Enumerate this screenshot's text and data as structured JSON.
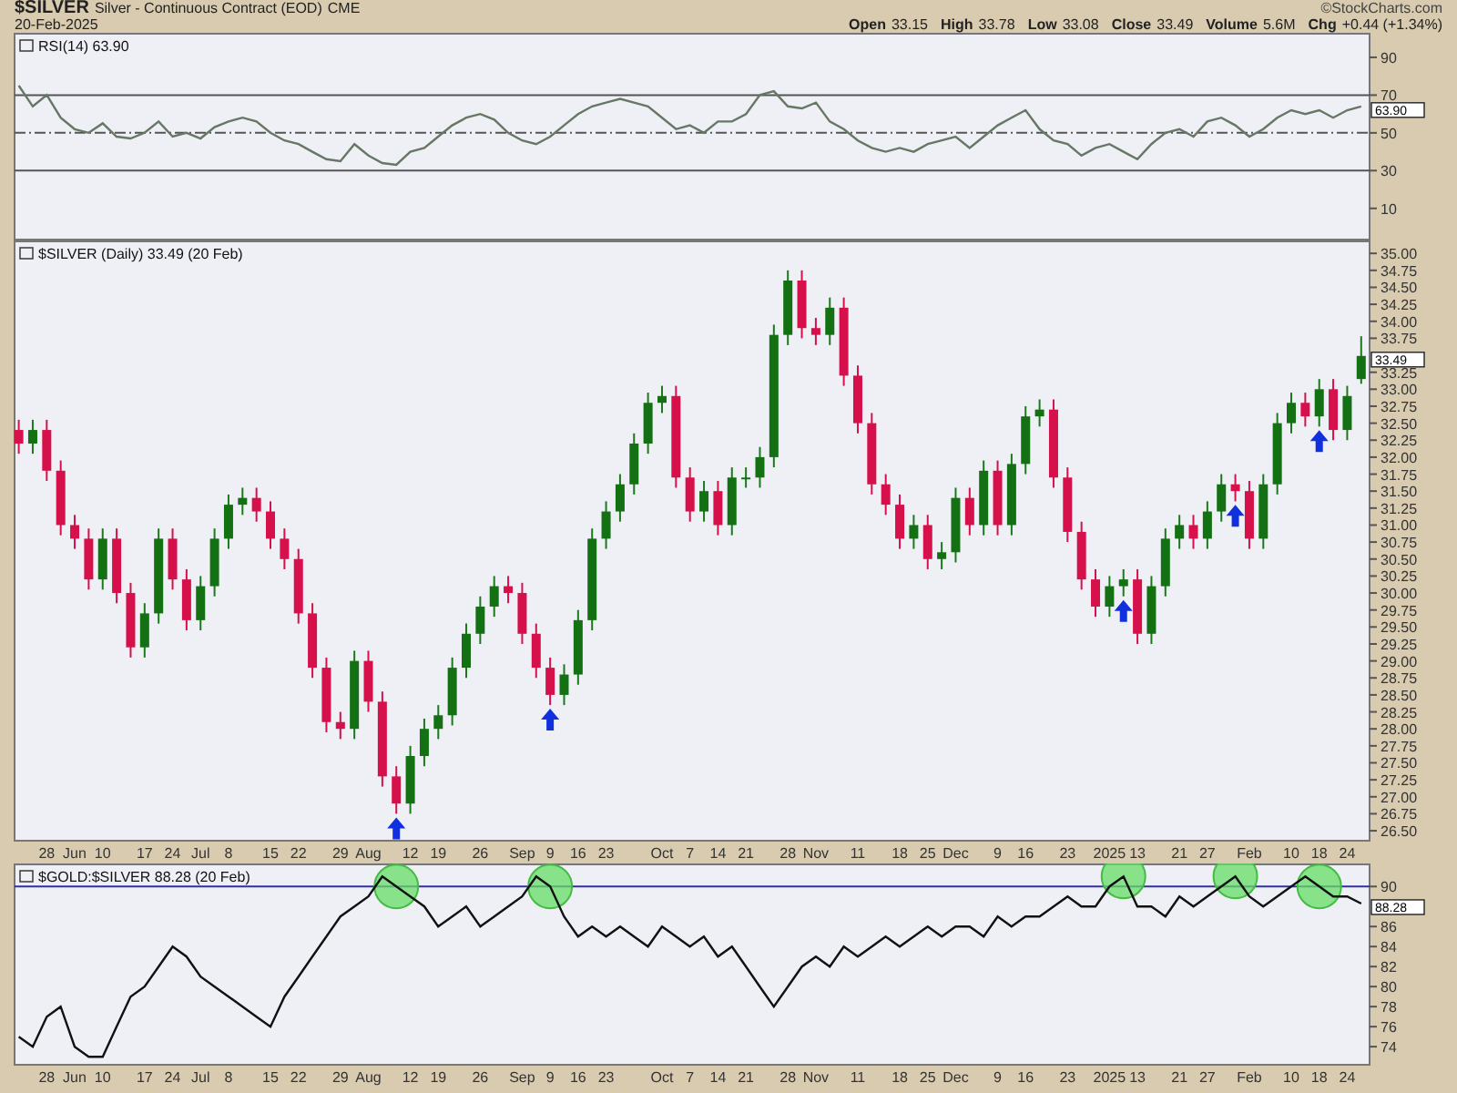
{
  "header": {
    "symbol": "$SILVER",
    "name": "Silver - Continuous Contract (EOD)",
    "exchange": "CME",
    "date": "20-Feb-2025",
    "credit": "©StockCharts.com",
    "quote": [
      {
        "label": "Open",
        "value": "33.15"
      },
      {
        "label": "High",
        "value": "33.78"
      },
      {
        "label": "Low",
        "value": "33.08"
      },
      {
        "label": "Close",
        "value": "33.49"
      },
      {
        "label": "Volume",
        "value": "5.6M"
      },
      {
        "label": "Chg",
        "value": "+0.44 (+1.34%)"
      }
    ]
  },
  "rsi_panel": {
    "legend_value": "63.90",
    "last_value": "63.90",
    "chart_data": {
      "type": "line",
      "ylim": [
        -7,
        103
      ],
      "yticks": [
        10,
        30,
        50,
        70,
        90
      ],
      "series": [
        {
          "name": "RSI(14)",
          "color": "#667766",
          "values": [
            75,
            64,
            70,
            58,
            52,
            50,
            55,
            48,
            47,
            50,
            56,
            48,
            50,
            47,
            53,
            56,
            58,
            56,
            50,
            46,
            44,
            40,
            36,
            35,
            44,
            38,
            34,
            33,
            40,
            42,
            48,
            54,
            58,
            60,
            57,
            50,
            46,
            44,
            48,
            54,
            60,
            64,
            66,
            68,
            66,
            64,
            58,
            52,
            54,
            50,
            56,
            56,
            60,
            70,
            72,
            64,
            63,
            66,
            56,
            52,
            46,
            42,
            40,
            42,
            40,
            44,
            46,
            48,
            42,
            48,
            54,
            58,
            62,
            52,
            46,
            44,
            38,
            42,
            44,
            40,
            36,
            44,
            50,
            52,
            48,
            56,
            58,
            54,
            48,
            52,
            58,
            62,
            60,
            62,
            58,
            62,
            64
          ]
        }
      ],
      "ref_lines": [
        {
          "axis": "y",
          "value": 70
        },
        {
          "axis": "y",
          "value": 50
        },
        {
          "axis": "y",
          "value": 30
        }
      ]
    }
  },
  "price_panel": {
    "legend_detail": "(Daily) 33.49 (20 Feb)",
    "last_value": "33.49",
    "chart_data": {
      "type": "candlestick",
      "title": "$SILVER",
      "ylim": [
        26.34,
        35.19
      ],
      "yticks": [
        {
          "value": 35,
          "label": "35.00"
        },
        {
          "value": 34.75,
          "label": "34.75"
        },
        {
          "value": 34.5,
          "label": "34.50"
        },
        {
          "value": 34.25,
          "label": "34.25"
        },
        {
          "value": 34,
          "label": "34.00"
        },
        {
          "value": 33.75,
          "label": "33.75"
        },
        {
          "value": 33.25,
          "label": "33.25"
        },
        {
          "value": 33,
          "label": "33.00"
        },
        {
          "value": 32.75,
          "label": "32.75"
        },
        {
          "value": 32.5,
          "label": "32.50"
        },
        {
          "value": 32.25,
          "label": "32.25"
        },
        {
          "value": 32,
          "label": "32.00"
        },
        {
          "value": 31.75,
          "label": "31.75"
        },
        {
          "value": 31.5,
          "label": "31.50"
        },
        {
          "value": 31.25,
          "label": "31.25"
        },
        {
          "value": 31,
          "label": "31.00"
        },
        {
          "value": 30.75,
          "label": "30.75"
        },
        {
          "value": 30.5,
          "label": "30.50"
        },
        {
          "value": 30.25,
          "label": "30.25"
        },
        {
          "value": 30,
          "label": "30.00"
        },
        {
          "value": 29.75,
          "label": "29.75"
        },
        {
          "value": 29.5,
          "label": "29.50"
        },
        {
          "value": 29.25,
          "label": "29.25"
        },
        {
          "value": 29,
          "label": "29.00"
        },
        {
          "value": 28.75,
          "label": "28.75"
        },
        {
          "value": 28.5,
          "label": "28.50"
        },
        {
          "value": 28.25,
          "label": "28.25"
        },
        {
          "value": 28,
          "label": "28.00"
        },
        {
          "value": 27.75,
          "label": "27.75"
        },
        {
          "value": 27.5,
          "label": "27.50"
        },
        {
          "value": 27.25,
          "label": "27.25"
        },
        {
          "value": 27,
          "label": "27.00"
        },
        {
          "value": 26.75,
          "label": "26.75"
        },
        {
          "value": 26.5,
          "label": "26.50"
        }
      ],
      "categories": [
        null,
        null,
        "28",
        null,
        "Jun",
        null,
        "10",
        null,
        null,
        "17",
        null,
        "24",
        null,
        "Jul",
        null,
        "8",
        null,
        null,
        "15",
        null,
        "22",
        null,
        null,
        "29",
        null,
        "Aug",
        null,
        null,
        "12",
        null,
        "19",
        null,
        null,
        "26",
        null,
        null,
        "Sep",
        null,
        "9",
        null,
        "16",
        null,
        "23",
        null,
        null,
        null,
        "Oct",
        null,
        "7",
        null,
        "14",
        null,
        "21",
        null,
        null,
        "28",
        null,
        "Nov",
        null,
        null,
        "11",
        null,
        null,
        "18",
        null,
        "25",
        null,
        "Dec",
        null,
        null,
        "9",
        null,
        "16",
        null,
        null,
        "23",
        null,
        null,
        "2025",
        null,
        "13",
        null,
        null,
        "21",
        null,
        "27",
        null,
        null,
        "Feb",
        null,
        null,
        "10",
        null,
        "18",
        null,
        "24",
        null
      ],
      "ohlc": [
        [
          32.4,
          32.55,
          32.05,
          32.2
        ],
        [
          32.2,
          32.55,
          32.05,
          32.4
        ],
        [
          32.4,
          32.55,
          31.65,
          31.8
        ],
        [
          31.8,
          31.95,
          30.85,
          31.0
        ],
        [
          31.0,
          31.15,
          30.65,
          30.8
        ],
        [
          30.8,
          30.95,
          30.05,
          30.2
        ],
        [
          30.2,
          30.95,
          30.05,
          30.8
        ],
        [
          30.8,
          30.95,
          29.85,
          30.0
        ],
        [
          30.0,
          30.15,
          29.05,
          29.2
        ],
        [
          29.2,
          29.85,
          29.05,
          29.7
        ],
        [
          29.7,
          30.95,
          29.55,
          30.8
        ],
        [
          30.8,
          30.95,
          30.05,
          30.2
        ],
        [
          30.2,
          30.35,
          29.45,
          29.6
        ],
        [
          29.6,
          30.25,
          29.45,
          30.1
        ],
        [
          30.1,
          30.95,
          29.95,
          30.8
        ],
        [
          30.8,
          31.45,
          30.65,
          31.3
        ],
        [
          31.3,
          31.55,
          31.15,
          31.4
        ],
        [
          31.4,
          31.55,
          31.05,
          31.2
        ],
        [
          31.2,
          31.35,
          30.65,
          30.8
        ],
        [
          30.8,
          30.95,
          30.35,
          30.5
        ],
        [
          30.5,
          30.65,
          29.55,
          29.7
        ],
        [
          29.7,
          29.85,
          28.75,
          28.9
        ],
        [
          28.9,
          29.05,
          27.95,
          28.1
        ],
        [
          28.1,
          28.25,
          27.85,
          28.0
        ],
        [
          28.0,
          29.15,
          27.85,
          29.0
        ],
        [
          29.0,
          29.15,
          28.25,
          28.4
        ],
        [
          28.4,
          28.55,
          27.15,
          27.3
        ],
        [
          27.3,
          27.45,
          26.75,
          26.9
        ],
        [
          26.9,
          27.75,
          26.75,
          27.6
        ],
        [
          27.6,
          28.15,
          27.45,
          28.0
        ],
        [
          28.0,
          28.35,
          27.85,
          28.2
        ],
        [
          28.2,
          29.05,
          28.05,
          28.9
        ],
        [
          28.9,
          29.55,
          28.75,
          29.4
        ],
        [
          29.4,
          29.95,
          29.25,
          29.8
        ],
        [
          29.8,
          30.25,
          29.65,
          30.1
        ],
        [
          30.1,
          30.25,
          29.85,
          30.0
        ],
        [
          30.0,
          30.15,
          29.25,
          29.4
        ],
        [
          29.4,
          29.55,
          28.75,
          28.9
        ],
        [
          28.9,
          29.05,
          28.35,
          28.5
        ],
        [
          28.5,
          28.95,
          28.35,
          28.8
        ],
        [
          28.8,
          29.75,
          28.65,
          29.6
        ],
        [
          29.6,
          30.95,
          29.45,
          30.8
        ],
        [
          30.8,
          31.35,
          30.65,
          31.2
        ],
        [
          31.2,
          31.75,
          31.05,
          31.6
        ],
        [
          31.6,
          32.35,
          31.45,
          32.2
        ],
        [
          32.2,
          32.95,
          32.05,
          32.8
        ],
        [
          32.8,
          33.05,
          32.65,
          32.9
        ],
        [
          32.9,
          33.05,
          31.55,
          31.7
        ],
        [
          31.7,
          31.85,
          31.05,
          31.2
        ],
        [
          31.2,
          31.65,
          31.05,
          31.5
        ],
        [
          31.5,
          31.65,
          30.85,
          31.0
        ],
        [
          31.0,
          31.85,
          30.85,
          31.7
        ],
        [
          31.7,
          31.85,
          31.55,
          31.7
        ],
        [
          31.7,
          32.15,
          31.55,
          32.0
        ],
        [
          32.0,
          33.95,
          31.85,
          33.8
        ],
        [
          33.8,
          34.75,
          33.65,
          34.6
        ],
        [
          34.6,
          34.75,
          33.75,
          33.9
        ],
        [
          33.9,
          34.05,
          33.65,
          33.8
        ],
        [
          33.8,
          34.35,
          33.65,
          34.2
        ],
        [
          34.2,
          34.35,
          33.05,
          33.2
        ],
        [
          33.2,
          33.35,
          32.35,
          32.5
        ],
        [
          32.5,
          32.65,
          31.45,
          31.6
        ],
        [
          31.6,
          31.75,
          31.15,
          31.3
        ],
        [
          31.3,
          31.45,
          30.65,
          30.8
        ],
        [
          30.8,
          31.15,
          30.65,
          31.0
        ],
        [
          31.0,
          31.15,
          30.35,
          30.5
        ],
        [
          30.5,
          30.75,
          30.35,
          30.6
        ],
        [
          30.6,
          31.55,
          30.45,
          31.4
        ],
        [
          31.4,
          31.55,
          30.85,
          31.0
        ],
        [
          31.0,
          31.95,
          30.85,
          31.8
        ],
        [
          31.8,
          31.95,
          30.85,
          31.0
        ],
        [
          31.0,
          32.05,
          30.85,
          31.9
        ],
        [
          31.9,
          32.75,
          31.75,
          32.6
        ],
        [
          32.6,
          32.85,
          32.45,
          32.7
        ],
        [
          32.7,
          32.85,
          31.55,
          31.7
        ],
        [
          31.7,
          31.85,
          30.75,
          30.9
        ],
        [
          30.9,
          31.05,
          30.05,
          30.2
        ],
        [
          30.2,
          30.35,
          29.65,
          29.8
        ],
        [
          29.8,
          30.25,
          29.65,
          30.1
        ],
        [
          30.1,
          30.35,
          29.95,
          30.2
        ],
        [
          30.2,
          30.35,
          29.25,
          29.4
        ],
        [
          29.4,
          30.25,
          29.25,
          30.1
        ],
        [
          30.1,
          30.95,
          29.95,
          30.8
        ],
        [
          30.8,
          31.15,
          30.65,
          31.0
        ],
        [
          31.0,
          31.15,
          30.65,
          30.8
        ],
        [
          30.8,
          31.35,
          30.65,
          31.2
        ],
        [
          31.2,
          31.75,
          31.05,
          31.6
        ],
        [
          31.6,
          31.75,
          31.35,
          31.5
        ],
        [
          31.5,
          31.65,
          30.65,
          30.8
        ],
        [
          30.8,
          31.75,
          30.65,
          31.6
        ],
        [
          31.6,
          32.65,
          31.45,
          32.5
        ],
        [
          32.5,
          32.95,
          32.35,
          32.8
        ],
        [
          32.8,
          32.95,
          32.45,
          32.6
        ],
        [
          32.6,
          33.15,
          32.45,
          33.0
        ],
        [
          33.0,
          33.15,
          32.25,
          32.4
        ],
        [
          32.4,
          33.05,
          32.25,
          32.9
        ],
        [
          33.15,
          33.78,
          33.08,
          33.49
        ]
      ]
    }
  },
  "ratio_panel": {
    "legend_value": "88.28 (20 Feb)",
    "last_value": "88.28",
    "chart_data": {
      "type": "line",
      "ylim": [
        72.1,
        92.3
      ],
      "yticks": [
        74,
        76,
        78,
        80,
        82,
        84,
        86,
        90
      ],
      "categories": [
        null,
        null,
        "28",
        null,
        "Jun",
        null,
        "10",
        null,
        null,
        "17",
        null,
        "24",
        null,
        "Jul",
        null,
        "8",
        null,
        null,
        "15",
        null,
        "22",
        null,
        null,
        "29",
        null,
        "Aug",
        null,
        null,
        "12",
        null,
        "19",
        null,
        null,
        "26",
        null,
        null,
        "Sep",
        null,
        "9",
        null,
        "16",
        null,
        "23",
        null,
        null,
        null,
        "Oct",
        null,
        "7",
        null,
        "14",
        null,
        "21",
        null,
        null,
        "28",
        null,
        "Nov",
        null,
        null,
        "11",
        null,
        null,
        "18",
        null,
        "25",
        null,
        "Dec",
        null,
        null,
        "9",
        null,
        "16",
        null,
        null,
        "23",
        null,
        null,
        "2025",
        null,
        "13",
        null,
        null,
        "21",
        null,
        "27",
        null,
        null,
        "Feb",
        null,
        null,
        "10",
        null,
        "18",
        null,
        "24",
        null
      ],
      "series": [
        {
          "name": "$GOLD:$SILVER",
          "color": "#111111",
          "values": [
            75,
            74,
            77,
            78,
            74,
            73,
            73,
            76,
            79,
            80,
            82,
            84,
            83,
            81,
            80,
            79,
            78,
            77,
            76,
            79,
            81,
            83,
            85,
            87,
            88,
            89,
            91,
            90,
            89,
            88,
            86,
            87,
            88,
            86,
            87,
            88,
            89,
            91,
            90,
            87,
            85,
            86,
            85,
            86,
            85,
            84,
            86,
            85,
            84,
            85,
            83,
            84,
            82,
            80,
            78,
            80,
            82,
            83,
            82,
            84,
            83,
            84,
            85,
            84,
            85,
            86,
            85,
            86,
            86,
            85,
            87,
            86,
            87,
            87,
            88,
            89,
            88,
            88,
            90,
            91,
            88,
            88,
            87,
            89,
            88,
            89,
            90,
            91,
            89,
            88,
            89,
            90,
            91,
            90,
            89,
            89,
            88.3
          ]
        }
      ],
      "ref_lines": [
        {
          "axis": "y",
          "value": 90
        }
      ]
    }
  }
}
